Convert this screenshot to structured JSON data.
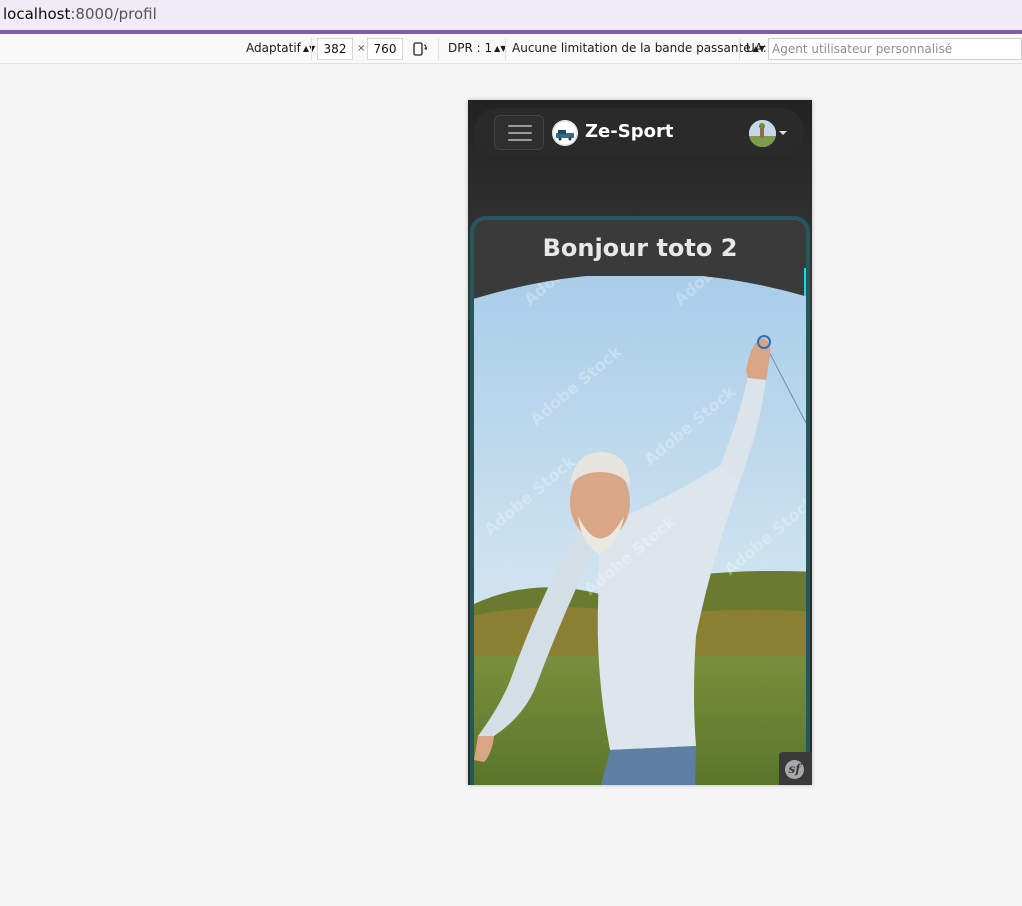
{
  "browser": {
    "url_host": "localhost",
    "url_rest": ":8000/profil"
  },
  "rdm_toolbar": {
    "device_mode": "Adaptatif",
    "width": "382",
    "times": "×",
    "height": "760",
    "dpr": "DPR : 1",
    "throttling": "Aucune limitation de la bande passante",
    "ua_label": "UA:",
    "ua_placeholder": "Agent utilisateur personnalisé"
  },
  "app": {
    "brand": "Ze-Sport",
    "greeting": "Bonjour toto 2",
    "watermark": "Adobe Stock",
    "colors": {
      "card_border": "#23585e",
      "accent": "#19d8ea",
      "browser_accent": "#7b5ea7"
    }
  }
}
